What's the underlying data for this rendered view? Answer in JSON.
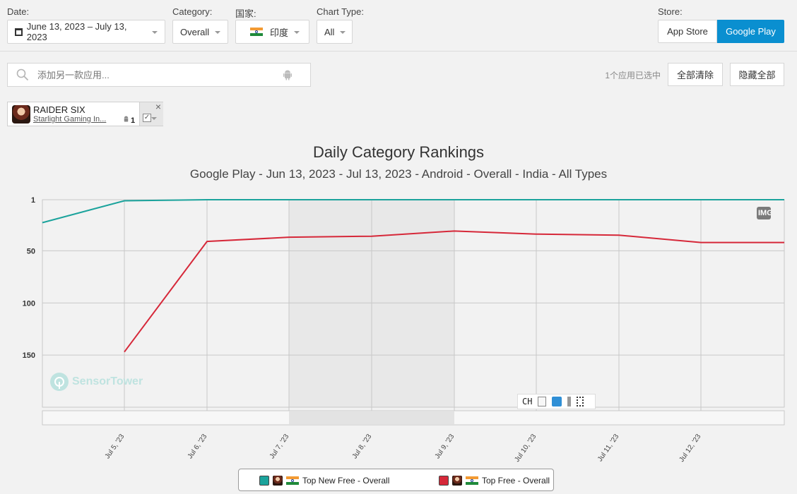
{
  "filters": {
    "date_label": "Date:",
    "date_value": "June 13, 2023 – July 13, 2023",
    "category_label": "Category:",
    "category_value": "Overall",
    "country_label": "国家:",
    "country_value": "印度",
    "chart_type_label": "Chart Type:",
    "chart_type_value": "All",
    "store_label": "Store:",
    "store_app_store": "App Store",
    "store_google_play": "Google Play"
  },
  "search": {
    "placeholder": "添加另一款应用...",
    "selected_count": "1个应用已选中",
    "clear_all": "全部清除",
    "hide_all": "隐藏全部"
  },
  "app": {
    "name": "RAIDER SIX",
    "publisher": "Starlight Gaming In...",
    "count": "1"
  },
  "colors": {
    "accent": "#0a8fd0",
    "series_teal": "#1ba39c",
    "series_red": "#d62839"
  },
  "chart": {
    "watermark": "SensorTower",
    "badge": "IMG",
    "toolbar_text": "CH"
  },
  "chart_data": {
    "type": "line",
    "title": "Daily Category Rankings",
    "subtitle": "Google Play - Jun 13, 2023 - Jul 13, 2023 - Android - Overall - India - All Types",
    "y_inverted": true,
    "ylim": [
      1,
      200
    ],
    "yticks": [
      1,
      50,
      100,
      150
    ],
    "x_tick_labels": [
      "Jul 5, '23",
      "Jul 6, '23",
      "Jul 7, '23",
      "Jul 8, '23",
      "Jul 9, '23",
      "Jul 10, '23",
      "Jul 11, '23",
      "Jul 12, '23"
    ],
    "x_range": [
      "Jul 4, '23",
      "Jul 13, '23"
    ],
    "series": [
      {
        "name": "Top New Free - Overall",
        "color": "#1ba39c",
        "points": [
          [
            "Jul 4, '23",
            23
          ],
          [
            "Jul 5, '23",
            2
          ],
          [
            "Jul 6, '23",
            1
          ],
          [
            "Jul 7, '23",
            1
          ],
          [
            "Jul 8, '23",
            1
          ],
          [
            "Jul 9, '23",
            1
          ],
          [
            "Jul 10, '23",
            1
          ],
          [
            "Jul 11, '23",
            1
          ],
          [
            "Jul 12, '23",
            1
          ],
          [
            "Jul 13, '23",
            1
          ]
        ]
      },
      {
        "name": "Top Free - Overall",
        "color": "#d62839",
        "points": [
          [
            "Jul 5, '23",
            147
          ],
          [
            "Jul 6, '23",
            41
          ],
          [
            "Jul 7, '23",
            37
          ],
          [
            "Jul 8, '23",
            36
          ],
          [
            "Jul 9, '23",
            31
          ],
          [
            "Jul 10, '23",
            34
          ],
          [
            "Jul 11, '23",
            35
          ],
          [
            "Jul 12, '23",
            42
          ],
          [
            "Jul 13, '23",
            42
          ]
        ]
      }
    ],
    "highlight_range": [
      "Jul 7, '23",
      "Jul 9, '23"
    ]
  },
  "legend": [
    {
      "name": "Top New Free - Overall",
      "color": "#1ba39c"
    },
    {
      "name": "Top Free - Overall",
      "color": "#d62839"
    }
  ]
}
